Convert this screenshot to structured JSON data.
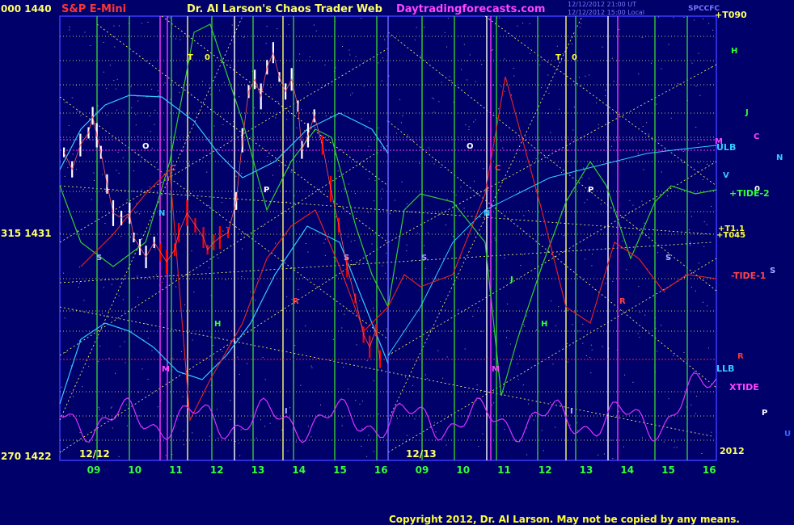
{
  "header": {
    "left_scale": "000 1440",
    "symbol": "S&P E-Mini",
    "title": "Dr. Al Larson's Chaos Trader Web",
    "site": "Daytradingforecasts.com",
    "timestamp_line1": "12/12/2012 21:00 UT",
    "timestamp_line2": "12/12/2012 15:00 Local",
    "right_tag": "SPCCFC",
    "top_right_label": "+T090"
  },
  "footer": {
    "copyright": "Copyright 2012, Dr. Al Larson. May not be copied by any means."
  },
  "colors": {
    "background": "#00006b",
    "frame": "#3a3aff",
    "price_bars": "#ffffff",
    "price_red": "#ff0000",
    "yellow_grid": "#ffff66",
    "green_grid": "#33cc33",
    "magenta": "#ff33ff",
    "cyan": "#33ccff",
    "green_line": "#33cc33",
    "red_line": "#ee2222",
    "violet_line": "#dd33ff",
    "label_green": "#33ff33",
    "label_yellow": "#ffff33",
    "copyright": "#ffff33",
    "site": "#ff44ff",
    "symbol": "#ff3333"
  },
  "chart_data": {
    "type": "line",
    "y_axis": {
      "range": [
        1422,
        1440
      ],
      "labels": [
        {
          "text": "000 1440",
          "value": 1440
        },
        {
          "text": "315 1431",
          "value": 1431
        },
        {
          "text": "270 1422",
          "value": 1422
        }
      ]
    },
    "date_labels": [
      {
        "text": "12/12",
        "hour": 8.5
      },
      {
        "text": "12/13",
        "hour": 8.5
      }
    ],
    "days": [
      {
        "name": "12/12",
        "ticks": [
          "09",
          "10",
          "11",
          "12",
          "13",
          "14",
          "15",
          "16"
        ]
      },
      {
        "name": "12/13",
        "ticks": [
          "09",
          "10",
          "11",
          "12",
          "13",
          "14",
          "15",
          "16"
        ]
      }
    ],
    "year_label": "2012",
    "price_series": {
      "name": "S&P E-Mini",
      "hour": [
        8.3,
        8.5,
        8.7,
        8.9,
        9.0,
        9.1,
        9.2,
        9.35,
        9.5,
        9.7,
        9.9,
        10.0,
        10.15,
        10.3,
        10.5,
        10.65,
        10.8,
        11.0,
        11.1,
        11.3,
        11.5,
        11.7,
        11.8,
        11.95,
        12.1,
        12.3,
        12.5,
        12.65,
        12.8,
        12.95,
        13.1,
        13.25,
        13.4,
        13.55,
        13.7,
        13.85,
        14.0,
        14.1,
        14.25,
        14.4,
        14.6,
        14.8,
        15.0,
        15.2,
        15.4,
        15.6,
        15.75,
        15.9,
        16.0
      ],
      "price": [
        1434.5,
        1433.8,
        1434.8,
        1435.3,
        1436.0,
        1435.2,
        1434.5,
        1433.2,
        1432.0,
        1431.8,
        1432.0,
        1431.0,
        1430.6,
        1430.2,
        1430.8,
        1430.4,
        1430.0,
        1430.5,
        1431.2,
        1432.0,
        1431.5,
        1431.0,
        1430.5,
        1430.8,
        1431.0,
        1431.2,
        1432.5,
        1435.0,
        1437.0,
        1437.5,
        1436.8,
        1438.0,
        1438.6,
        1437.6,
        1437.0,
        1437.5,
        1436.4,
        1434.6,
        1435.2,
        1436.0,
        1434.8,
        1433.0,
        1431.5,
        1429.8,
        1428.5,
        1427.0,
        1426.5,
        1427.2,
        1426.0
      ]
    },
    "line_labels": [
      {
        "text": "+TIDE-2",
        "color": "#33ff33"
      },
      {
        "text": "-TIDE-1",
        "color": "#ff4444"
      },
      {
        "text": "XTIDE",
        "color": "#ff44ff"
      },
      {
        "text": "ULB",
        "color": "#33ccff"
      },
      {
        "text": "LLB",
        "color": "#33ccff"
      },
      {
        "text": "+T045",
        "color": "#ffff33"
      },
      {
        "text": "+T1.1",
        "color": "#ffff33"
      }
    ],
    "planet_labels": [
      "H",
      "J",
      "C",
      "N",
      "M",
      "V",
      "0",
      "S",
      "R",
      "P",
      "U"
    ],
    "day_markers": [
      "T",
      "0",
      "C",
      "N",
      "S",
      "P",
      "H",
      "R",
      "M",
      "J",
      "I"
    ]
  }
}
